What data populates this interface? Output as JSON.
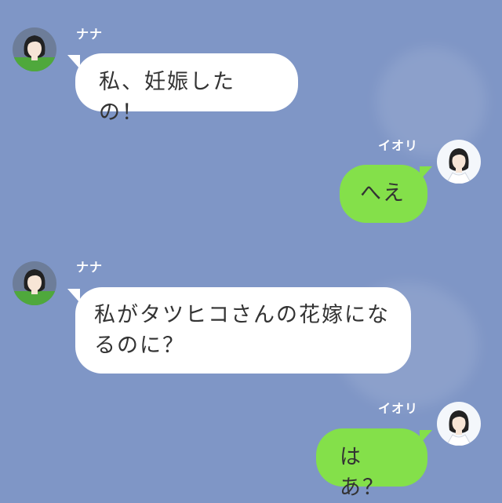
{
  "messages": [
    {
      "sender": "ナナ",
      "side": "left",
      "text": "私、妊娠したの！"
    },
    {
      "sender": "イオリ",
      "side": "right",
      "text": "へえ"
    },
    {
      "sender": "ナナ",
      "side": "left",
      "text_lines": [
        "私がタツヒコさんの花嫁にな",
        "るのに？"
      ]
    },
    {
      "sender": "イオリ",
      "side": "right",
      "text": "はあ？"
    }
  ],
  "colors": {
    "background": "#7f96c6",
    "bubble_incoming": "#ffffff",
    "bubble_outgoing": "#84e04a",
    "text": "#333333",
    "name_text": "#ffffff"
  }
}
